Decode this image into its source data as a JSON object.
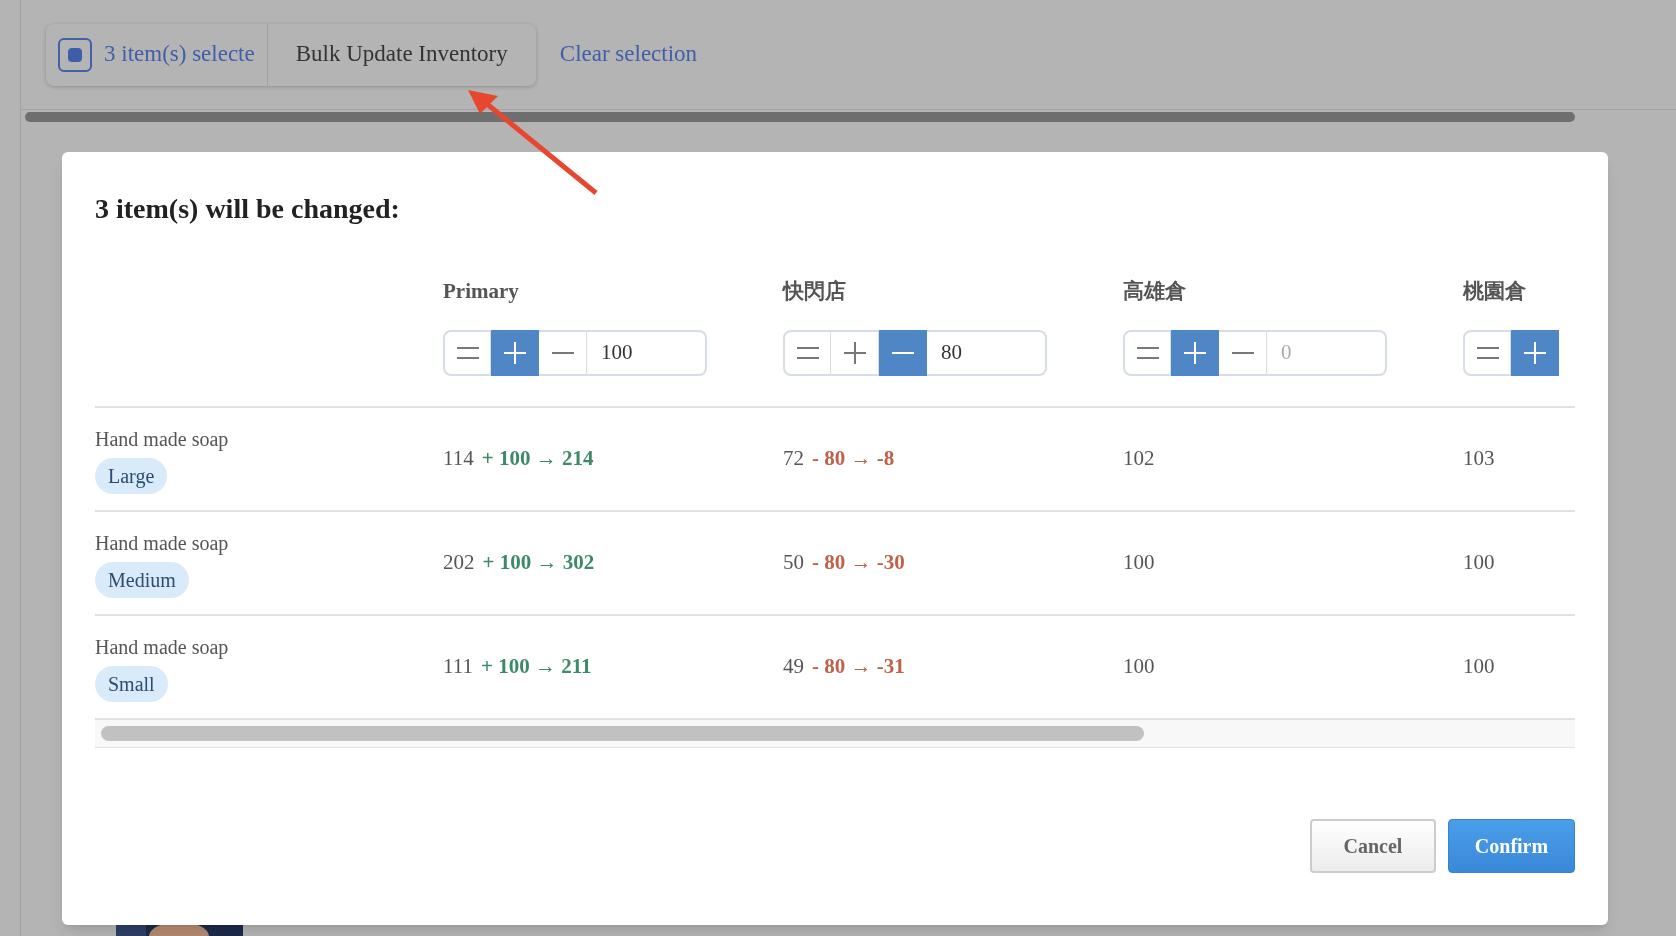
{
  "selection_bar": {
    "checkbox": {
      "indeterminate": true
    },
    "count_label": "3 item(s) selecte",
    "bulk_button": "Bulk Update Inventory",
    "clear_link": "Clear selection"
  },
  "dialog": {
    "title": "3 item(s) will be changed:",
    "columns": [
      {
        "label": "Primary",
        "modes": [
          {
            "kind": "set",
            "selected": false
          },
          {
            "kind": "add",
            "selected": true
          },
          {
            "kind": "subtract",
            "selected": false
          }
        ],
        "value": "100"
      },
      {
        "label": "快閃店",
        "modes": [
          {
            "kind": "set",
            "selected": false
          },
          {
            "kind": "add",
            "selected": false
          },
          {
            "kind": "subtract",
            "selected": true
          }
        ],
        "value": "80"
      },
      {
        "label": "高雄倉",
        "modes": [
          {
            "kind": "set",
            "selected": false
          },
          {
            "kind": "add",
            "selected": true
          },
          {
            "kind": "subtract",
            "selected": false
          }
        ],
        "placeholder": "0"
      },
      {
        "label": "桃園倉",
        "modes": [
          {
            "kind": "set",
            "selected": false
          },
          {
            "kind": "add",
            "selected": true
          }
        ]
      }
    ],
    "rows": [
      {
        "name": "Hand made soap",
        "variant": "Large",
        "cells": [
          {
            "kind": "add",
            "base": "114",
            "change": "+ 100 → 214"
          },
          {
            "kind": "subtract",
            "base": "72",
            "change": "- 80 → -8"
          },
          {
            "kind": "none",
            "base": "102"
          },
          {
            "kind": "none",
            "base": "103"
          }
        ]
      },
      {
        "name": "Hand made soap",
        "variant": "Medium",
        "cells": [
          {
            "kind": "add",
            "base": "202",
            "change": "+ 100 → 302"
          },
          {
            "kind": "subtract",
            "base": "50",
            "change": "- 80 → -30"
          },
          {
            "kind": "none",
            "base": "100"
          },
          {
            "kind": "none",
            "base": "100"
          }
        ]
      },
      {
        "name": "Hand made soap",
        "variant": "Small",
        "cells": [
          {
            "kind": "add",
            "base": "111",
            "change": "+ 100 → 211"
          },
          {
            "kind": "subtract",
            "base": "49",
            "change": "- 80 → -31"
          },
          {
            "kind": "none",
            "base": "100"
          },
          {
            "kind": "none",
            "base": "100"
          }
        ]
      }
    ],
    "buttons": {
      "cancel": "Cancel",
      "confirm": "Confirm"
    }
  }
}
